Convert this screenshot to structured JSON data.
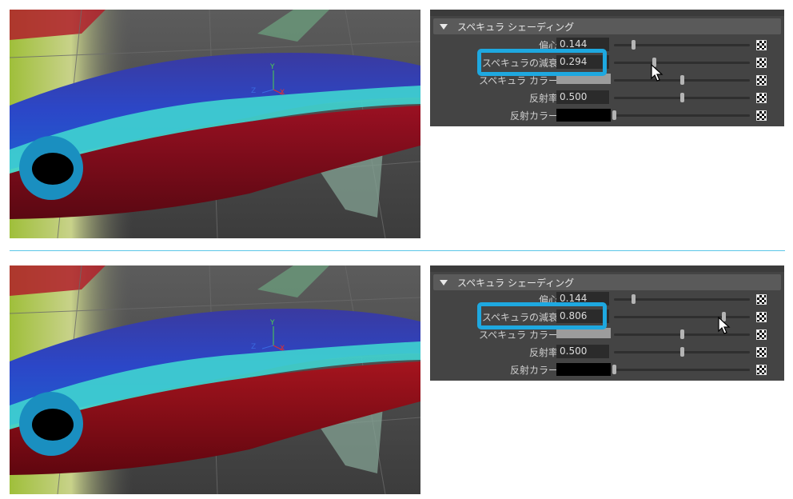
{
  "panels": [
    {
      "section_title": "スペキュラ シェーディング",
      "rows": [
        {
          "label": "偏心",
          "value": "0.144",
          "slider": 0.144
        },
        {
          "label": "スペキュラの減衰",
          "value": "0.294",
          "slider": 0.294
        },
        {
          "label": "スペキュラ カラー",
          "slider": 0.5
        },
        {
          "label": "反射率",
          "value": "0.500",
          "slider": 0.5
        },
        {
          "label": "反射カラー",
          "slider": 0.0
        }
      ]
    },
    {
      "section_title": "スペキュラ シェーディング",
      "rows": [
        {
          "label": "偏心",
          "value": "0.144",
          "slider": 0.144
        },
        {
          "label": "スペキュラの減衰",
          "value": "0.806",
          "slider": 0.806
        },
        {
          "label": "スペキュラ カラー",
          "slider": 0.5
        },
        {
          "label": "反射率",
          "value": "0.500",
          "slider": 0.5
        },
        {
          "label": "反射カラー",
          "slider": 0.0
        }
      ]
    }
  ],
  "axis_labels": {
    "x": "X",
    "y": "Y",
    "z": "Z"
  },
  "colors": {
    "highlight": "#1ea8e0",
    "divider": "#5bc7e8",
    "panel_bg": "#444444"
  }
}
